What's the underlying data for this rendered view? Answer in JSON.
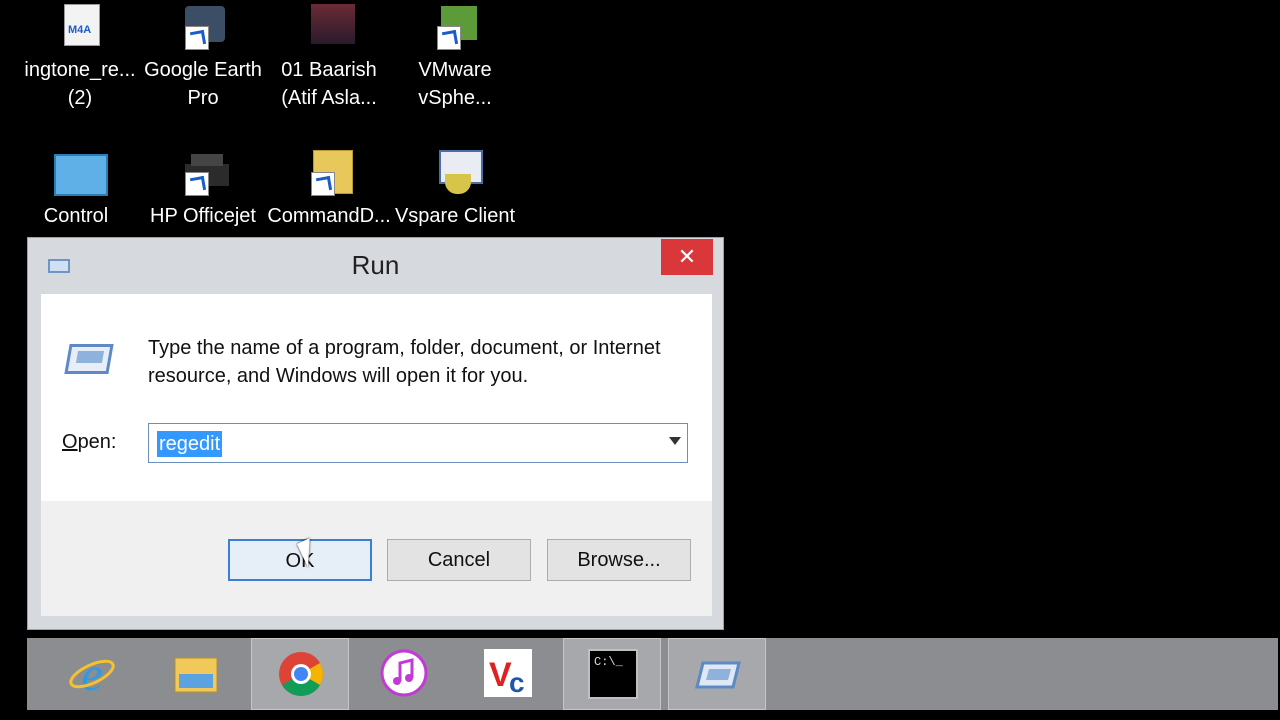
{
  "desktop": {
    "icons": [
      {
        "label_line1": "ingtone_re...",
        "label_line2": "(2)",
        "badge": "M4A",
        "icon": "m4a-file-icon"
      },
      {
        "label_line1": "Google Earth",
        "label_line2": "Pro",
        "icon": "google-earth-icon"
      },
      {
        "label_line1": "01 Baarish",
        "label_line2": "(Atif Asla...",
        "icon": "audio-file-icon"
      },
      {
        "label_line1": "VMware",
        "label_line2": "vSphe...",
        "icon": "vmware-icon"
      },
      {
        "label_line1": "Control",
        "label_line2": "",
        "icon": "control-panel-icon"
      },
      {
        "label_line1": "HP Officejet",
        "label_line2": "",
        "icon": "printer-icon"
      },
      {
        "label_line1": "CommandD...",
        "label_line2": "",
        "icon": "folder-icon"
      },
      {
        "label_line1": "Vspare Client",
        "label_line2": "",
        "icon": "vspare-icon"
      }
    ]
  },
  "run_dialog": {
    "title": "Run",
    "close_glyph": "✕",
    "description": "Type the name of a program, folder, document, or Internet resource, and Windows will open it for you.",
    "open_label_accel": "O",
    "open_label_rest": "pen:",
    "open_value": "regedit",
    "ok_label": "OK",
    "cancel_label": "Cancel",
    "browse_label": "Browse..."
  },
  "taskbar": {
    "items": [
      {
        "name": "internet-explorer-icon",
        "active": false
      },
      {
        "name": "file-explorer-icon",
        "active": false
      },
      {
        "name": "chrome-icon",
        "active": true
      },
      {
        "name": "itunes-icon",
        "active": false
      },
      {
        "name": "vnc-icon",
        "active": false
      },
      {
        "name": "command-prompt-icon",
        "active": true
      },
      {
        "name": "run-icon",
        "active": true
      }
    ],
    "cmd_text": "C:\\_"
  },
  "colors": {
    "close_red": "#d9373a",
    "selection_blue": "#3399ff",
    "taskbar_gray": "#8b8d90"
  }
}
